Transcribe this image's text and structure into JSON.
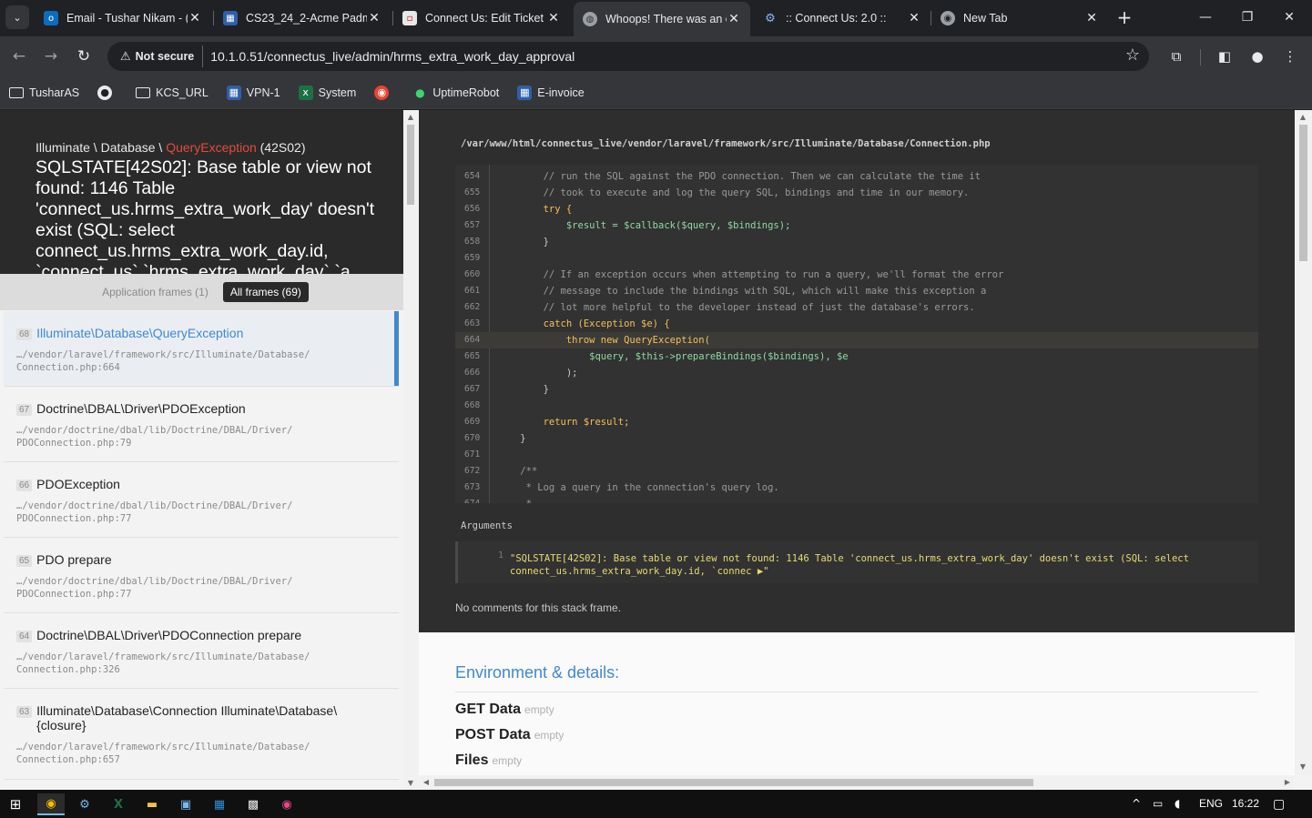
{
  "browser": {
    "tabs": [
      {
        "title": "Email - Tushar Nikam - (",
        "icon": "outlook-icon",
        "color": "#0f6cbd"
      },
      {
        "title": "CS23_24_2-Acme Padm",
        "icon": "grid-icon",
        "color": "#2f5faa"
      },
      {
        "title": "Connect Us: Edit Ticket",
        "icon": "page-icon",
        "color": "#e8e8e8"
      },
      {
        "title": "Whoops! There was an e",
        "icon": "globe-icon",
        "color": "#9aa0a6"
      },
      {
        "title": ":: Connect Us: 2.0 ::",
        "icon": "gear-icon",
        "color": "#8ab4f8"
      },
      {
        "title": "New Tab",
        "icon": "chrome-icon",
        "color": "#9aa0a6"
      }
    ],
    "active_tab": 3,
    "security_label": "Not secure",
    "url": "10.1.0.51/connectus_live/admin/hrms_extra_work_day_approval",
    "bookmarks": [
      {
        "label": "TusharAS",
        "icon": "folder-icon"
      },
      {
        "label": "",
        "icon": "app-icon"
      },
      {
        "label": "KCS_URL",
        "icon": "folder-icon"
      },
      {
        "label": "VPN-1",
        "icon": "network-icon"
      },
      {
        "label": "System",
        "icon": "excel-icon"
      },
      {
        "label": "",
        "icon": "chrome-icon"
      },
      {
        "label": "UptimeRobot",
        "icon": "dot-icon"
      },
      {
        "label": "E-invoice",
        "icon": "network-icon"
      }
    ]
  },
  "exception": {
    "namespace": "Illuminate \\ Database \\ ",
    "class": "QueryException",
    "code": " (42S02)",
    "message": "SQLSTATE[42S02]: Base table or view not found: 1146 Table 'connect_us.hrms_extra_work_day' doesn't exist (SQL: select connect_us.hrms_extra_work_day.id, `connect_us`.`hrms_extra_work_day`.`a"
  },
  "filters": {
    "application": "Application frames (1)",
    "all": "All frames (69)"
  },
  "frames": [
    {
      "index": "68",
      "class": "Illuminate\\Database\\QueryException",
      "file": "…/vendor/laravel/framework/src/Illuminate/Database/\nConnection.php:664"
    },
    {
      "index": "67",
      "class": "Doctrine\\DBAL\\Driver\\PDOException",
      "file": "…/vendor/doctrine/dbal/lib/Doctrine/DBAL/Driver/\nPDOConnection.php:79"
    },
    {
      "index": "66",
      "class": "PDOException",
      "file": "…/vendor/doctrine/dbal/lib/Doctrine/DBAL/Driver/\nPDOConnection.php:77"
    },
    {
      "index": "65",
      "class": "PDO prepare",
      "file": "…/vendor/doctrine/dbal/lib/Doctrine/DBAL/Driver/\nPDOConnection.php:77"
    },
    {
      "index": "64",
      "class": "Doctrine\\DBAL\\Driver\\PDOConnection prepare",
      "file": "…/vendor/laravel/framework/src/Illuminate/Database/\nConnection.php:326"
    },
    {
      "index": "63",
      "class": "Illuminate\\Database\\Connection Illuminate\\Database\\\n{closure}",
      "file": "…/vendor/laravel/framework/src/Illuminate/Database/\nConnection.php:657"
    }
  ],
  "code": {
    "file_path": "/var/www/html/connectus_live/vendor/laravel/framework/src/Illuminate/Database/Connection.php",
    "highlight_line": "664",
    "lines": [
      {
        "n": "654",
        "t": "        // run the SQL against the PDO connection. Then we can calculate the time it"
      },
      {
        "n": "655",
        "t": "        // took to execute and log the query SQL, bindings and time in our memory."
      },
      {
        "n": "656",
        "t": "        try {"
      },
      {
        "n": "657",
        "t": "            $result = $callback($query, $bindings);"
      },
      {
        "n": "658",
        "t": "        }"
      },
      {
        "n": "659",
        "t": ""
      },
      {
        "n": "660",
        "t": "        // If an exception occurs when attempting to run a query, we'll format the error"
      },
      {
        "n": "661",
        "t": "        // message to include the bindings with SQL, which will make this exception a"
      },
      {
        "n": "662",
        "t": "        // lot more helpful to the developer instead of just the database's errors."
      },
      {
        "n": "663",
        "t": "        catch (Exception $e) {"
      },
      {
        "n": "664",
        "t": "            throw new QueryException("
      },
      {
        "n": "665",
        "t": "                $query, $this->prepareBindings($bindings), $e"
      },
      {
        "n": "666",
        "t": "            );"
      },
      {
        "n": "667",
        "t": "        }"
      },
      {
        "n": "668",
        "t": ""
      },
      {
        "n": "669",
        "t": "        return $result;"
      },
      {
        "n": "670",
        "t": "    }"
      },
      {
        "n": "671",
        "t": ""
      },
      {
        "n": "672",
        "t": "    /**"
      },
      {
        "n": "673",
        "t": "     * Log a query in the connection's query log."
      },
      {
        "n": "674",
        "t": "     *"
      }
    ]
  },
  "arguments": {
    "label": "Arguments",
    "index": "1",
    "value": "\"SQLSTATE[42S02]: Base table or view not found: 1146 Table 'connect_us.hrms_extra_work_day' doesn't exist (SQL: select connect_us.hrms_extra_work_day.id, `connec ▶\""
  },
  "no_comments": "No comments for this stack frame.",
  "environment": {
    "title": "Environment & details:",
    "rows": [
      {
        "label": "GET Data",
        "value": "empty"
      },
      {
        "label": "POST Data",
        "value": "empty"
      },
      {
        "label": "Files",
        "value": "empty"
      }
    ]
  },
  "taskbar": {
    "language": "ENG",
    "time": "16:22"
  }
}
